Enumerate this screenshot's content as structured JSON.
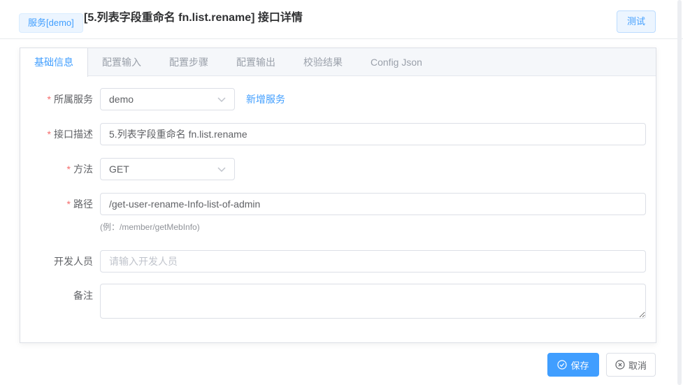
{
  "header": {
    "service_badge": "服务[demo]",
    "title": "[5.列表字段重命名 fn.list.rename] 接口详情",
    "test_button": "测试"
  },
  "tabs": [
    {
      "label": "基础信息",
      "active": true
    },
    {
      "label": "配置输入",
      "active": false
    },
    {
      "label": "配置步骤",
      "active": false
    },
    {
      "label": "配置输出",
      "active": false
    },
    {
      "label": "校验结果",
      "active": false
    },
    {
      "label": "Config Json",
      "active": false
    }
  ],
  "form": {
    "required_marker": "*",
    "service": {
      "label": "所属服务",
      "required": true,
      "value": "demo",
      "add_link": "新增服务"
    },
    "description": {
      "label": "接口描述",
      "required": true,
      "value": "5.列表字段重命名 fn.list.rename"
    },
    "method": {
      "label": "方法",
      "required": true,
      "value": "GET"
    },
    "path": {
      "label": "路径",
      "required": true,
      "value": "/get-user-rename-Info-list-of-admin",
      "hint": "(例：/member/getMebInfo)"
    },
    "developer": {
      "label": "开发人员",
      "required": false,
      "value": "",
      "placeholder": "请输入开发人员"
    },
    "remark": {
      "label": "备注",
      "required": false,
      "value": ""
    }
  },
  "footer": {
    "save": "保存",
    "cancel": "取消"
  },
  "icons": {
    "dropdown": "chevron-down",
    "save": "circle-check",
    "cancel": "circle-close"
  },
  "colors": {
    "accent": "#409EFF",
    "accent_light_bg": "#ECF5FF",
    "required": "#F56C6C",
    "tab_header_bg": "#F5F7FA",
    "border": "#DCDFE6"
  }
}
